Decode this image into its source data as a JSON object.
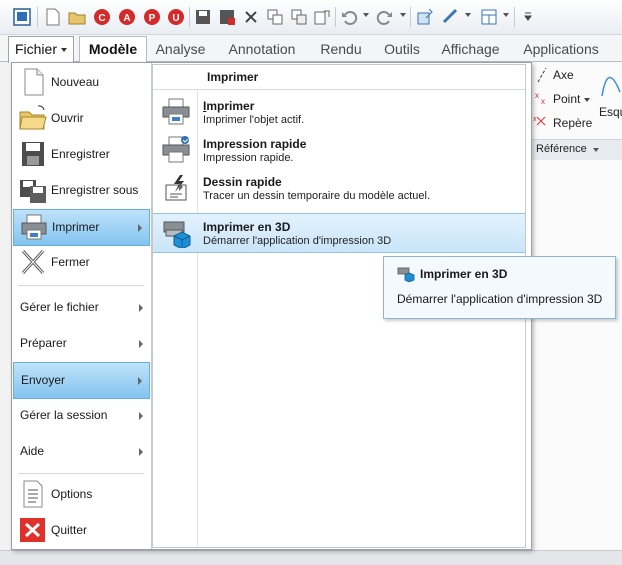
{
  "tabs": {
    "file": "Fichier",
    "items": [
      "Modèle",
      "Analyse",
      "Annotation",
      "Rendu",
      "Outils",
      "Affichage",
      "Applications"
    ]
  },
  "ribbon": {
    "axe": "Axe",
    "point": "Point",
    "repere": "Repère",
    "esq": "Esqu",
    "reference": "Référence"
  },
  "menu": {
    "left": [
      {
        "label": "Nouveau",
        "icon": "new-document-icon"
      },
      {
        "label": "Ouvrir",
        "icon": "open-folder-icon"
      },
      {
        "label": "Enregistrer",
        "icon": "save-icon"
      },
      {
        "label": "Enregistrer sous",
        "icon": "save-as-icon"
      },
      {
        "label": "Imprimer",
        "icon": "printer-icon"
      },
      {
        "label": "Fermer",
        "icon": "close-x-icon"
      },
      {
        "label": "Gérer le fichier"
      },
      {
        "label": "Préparer"
      },
      {
        "label": "Envoyer"
      },
      {
        "label": "Gérer la session"
      },
      {
        "label": "Aide"
      },
      {
        "label": "Options",
        "icon": "options-icon"
      },
      {
        "label": "Quitter",
        "icon": "quit-icon"
      }
    ],
    "right_title": "Imprimer",
    "right": [
      {
        "title": "Imprimer",
        "desc": "Imprimer l'objet actif."
      },
      {
        "title": "Impression rapide",
        "desc": "Impression rapide."
      },
      {
        "title": "Dessin rapide",
        "desc": "Tracer un dessin temporaire du modèle actuel."
      },
      {
        "title": "Imprimer en 3D",
        "desc": "Démarrer l'application d'impression 3D"
      }
    ]
  },
  "tooltip": {
    "title": "Imprimer en 3D",
    "desc": "Démarrer l'application d'impression 3D"
  },
  "colors": {
    "highlight": "#83c4f0",
    "tooltip_border": "#8eb4d6",
    "quit_red": "#e0302a"
  }
}
